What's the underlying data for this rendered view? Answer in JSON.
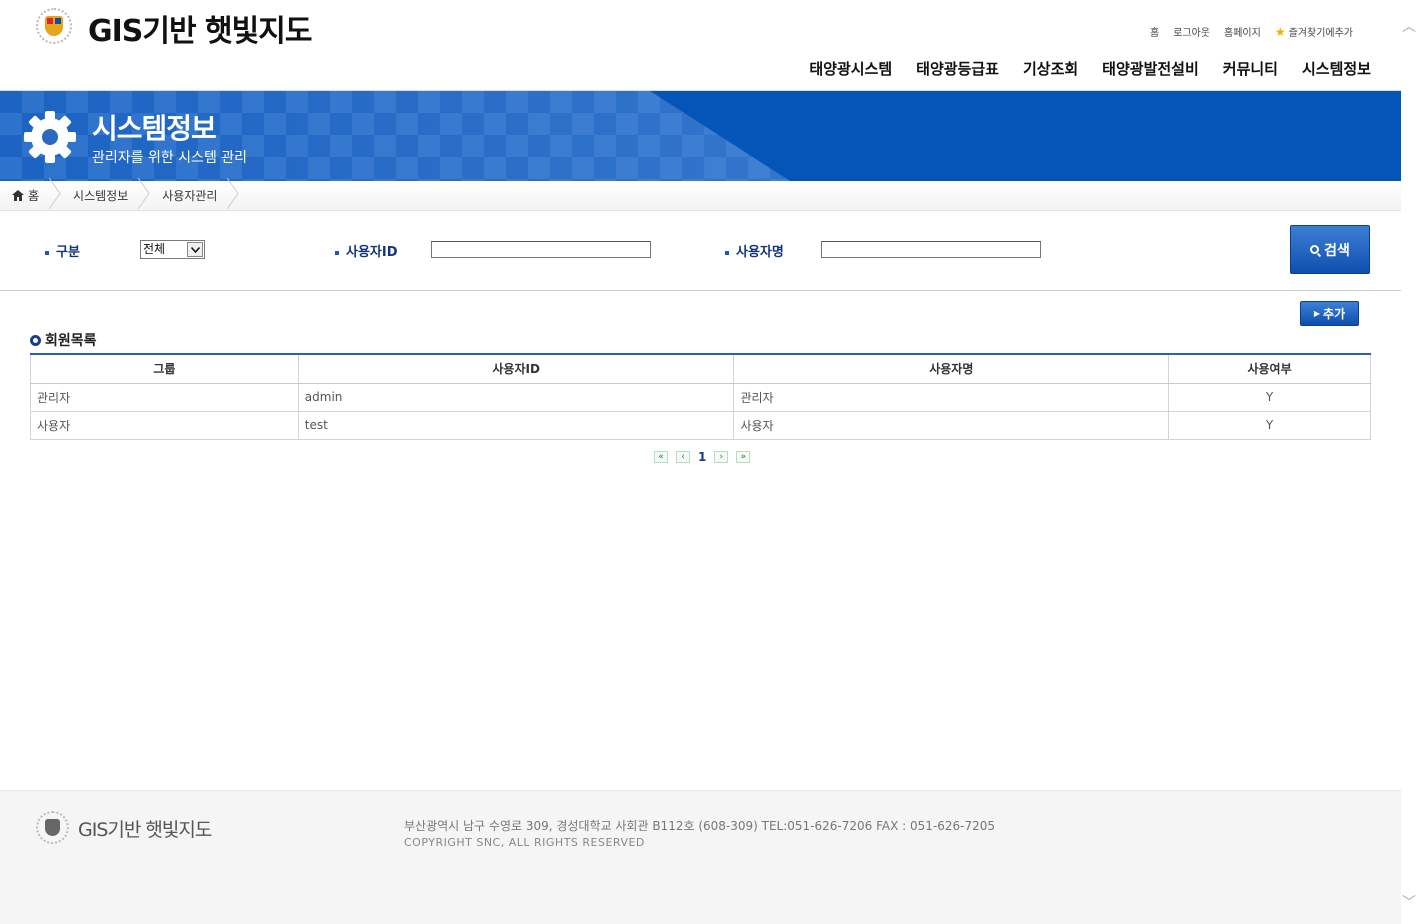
{
  "header": {
    "site_title": "GIS기반 햇빛지도",
    "util_links": {
      "home": "홈",
      "logout": "로그아웃",
      "homepage": "홈페이지",
      "bookmark": "즐겨찾기에추가"
    },
    "nav": [
      "태양광시스템",
      "태양광등급표",
      "기상조회",
      "태양광발전설비",
      "커뮤니티",
      "시스템정보"
    ]
  },
  "banner": {
    "title": "시스템정보",
    "subtitle": "관리자를 위한 시스템 관리"
  },
  "breadcrumb": [
    "홈",
    "시스템정보",
    "사용자관리"
  ],
  "search": {
    "category_label": "구분",
    "category_value": "전체",
    "userid_label": "사용자ID",
    "userid_value": "",
    "username_label": "사용자명",
    "username_value": "",
    "search_button": "검색"
  },
  "add_button": "추가",
  "list": {
    "title": "회원목록",
    "columns": [
      "그룹",
      "사용자ID",
      "사용자명",
      "사용여부"
    ],
    "rows": [
      [
        "관리자",
        "admin",
        "관리자",
        "Y"
      ],
      [
        "사용자",
        "test",
        "사용자",
        "Y"
      ]
    ]
  },
  "pagination": {
    "current_page": "1"
  },
  "footer": {
    "site_title": "GIS기반 햇빛지도",
    "address": "부산광역시 남구 수영로 309, 경성대학교 사회관 B112호 (608-309) TEL:051-626-7206 FAX : 051-626-7205",
    "copyright": "COPYRIGHT SNC, ALL RIGHTS RESERVED"
  },
  "colors": {
    "primary": "#0554b8",
    "label": "#13367a",
    "table_top": "#2a5fb3"
  }
}
